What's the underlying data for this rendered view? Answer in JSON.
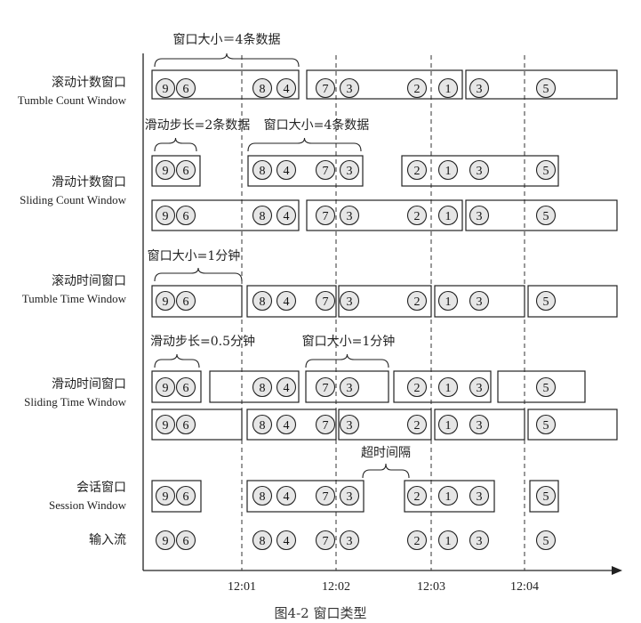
{
  "rows": [
    {
      "cn": "滚动计数窗口",
      "en": "Tumble Count Window"
    },
    {
      "cn": "滑动计数窗口",
      "en": "Sliding Count Window"
    },
    {
      "cn": "滚动时间窗口",
      "en": "Tumble Time Window"
    },
    {
      "cn": "滑动时间窗口",
      "en": "Sliding Time Window"
    },
    {
      "cn": "会话窗口",
      "en": "Session Window"
    },
    {
      "cn": "输入流",
      "en": ""
    }
  ],
  "annotations": [
    "窗口大小＝4条数据",
    "滑动步长=2条数据",
    "窗口大小=4条数据",
    "窗口大小=1分钟",
    "滑动步长=0.5分钟",
    "窗口大小=1分钟",
    "超时间隔"
  ],
  "time_ticks": [
    "12:01",
    "12:02",
    "12:03",
    "12:04"
  ],
  "input_stream": [
    "9",
    "6",
    "8",
    "4",
    "7",
    "3",
    "2",
    "1",
    "3",
    "5"
  ],
  "caption": "图4-2  窗口类型"
}
